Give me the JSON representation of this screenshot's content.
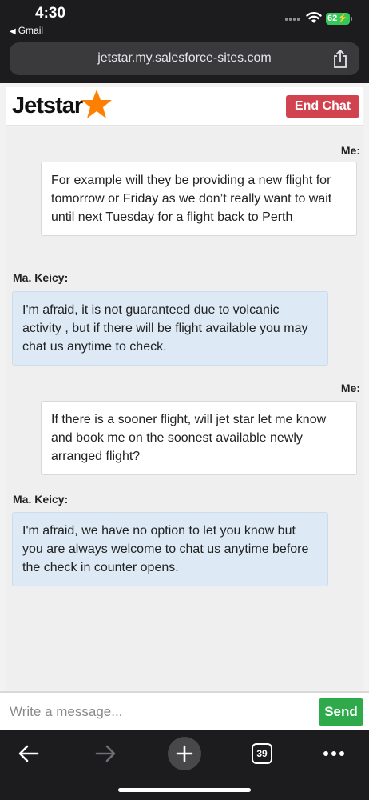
{
  "status_bar": {
    "time": "4:30",
    "back_app": "Gmail",
    "battery": "62"
  },
  "browser": {
    "url": "jetstar.my.salesforce-sites.com",
    "tabs_count": "39"
  },
  "header": {
    "logo_text": "Jetstar",
    "end_chat_label": "End Chat",
    "brand_color": "#ff7f00"
  },
  "messages": [
    {
      "sender": "Me:",
      "text": "For example will they be providing a new flight for tomorrow or Friday as we don’t really want to wait until next Tuesday for a flight back to Perth"
    },
    {
      "sender": "Ma. Keicy:",
      "text": "I'm afraid, it is not guaranteed due to volcanic activity , but if there will be flight available you may chat us anytime to check."
    },
    {
      "sender": "Me:",
      "text": "If there is a sooner flight, will jet star let me know and book me on the soonest available newly arranged flight?"
    },
    {
      "sender": "Ma. Keicy:",
      "text": "I'm afraid, we have no option to let you know but you are always welcome to chat us anytime before the check in counter opens."
    }
  ],
  "composer": {
    "placeholder": "Write a message...",
    "send_label": "Send"
  },
  "colors": {
    "end_chat": "#d1434f",
    "send": "#2eaa4a",
    "agent_bubble": "#ddeaf6"
  }
}
